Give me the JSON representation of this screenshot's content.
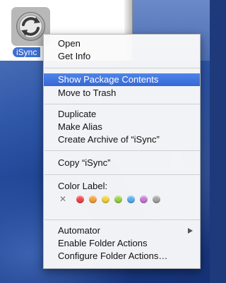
{
  "icon": {
    "name": "iSync",
    "label": "iSync"
  },
  "menu": {
    "items": [
      {
        "label": "Open",
        "group": 1
      },
      {
        "label": "Get Info",
        "group": 1
      },
      {
        "label": "Show Package Contents",
        "group": 2,
        "highlighted": true
      },
      {
        "label": "Move to Trash",
        "group": 2
      },
      {
        "label": "Duplicate",
        "group": 3
      },
      {
        "label": "Make Alias",
        "group": 3
      },
      {
        "label": "Create Archive of “iSync”",
        "group": 3
      },
      {
        "label": "Copy “iSync”",
        "group": 4
      },
      {
        "label": "Color Label:",
        "group": 5
      },
      {
        "label": "Automator",
        "group": 6,
        "submenu": true
      },
      {
        "label": "Enable Folder Actions",
        "group": 6
      },
      {
        "label": "Configure Folder Actions…",
        "group": 6
      }
    ],
    "color_labels": {
      "none_symbol": "✕",
      "colors": [
        {
          "name": "red",
          "hex": "#f0484a"
        },
        {
          "name": "orange",
          "hex": "#f6a23a"
        },
        {
          "name": "yellow",
          "hex": "#f3d43a"
        },
        {
          "name": "green",
          "hex": "#9ad443"
        },
        {
          "name": "blue",
          "hex": "#5aaef0"
        },
        {
          "name": "purple",
          "hex": "#c77ad6"
        },
        {
          "name": "gray",
          "hex": "#a5a5a5"
        }
      ]
    }
  },
  "colors": {
    "highlight": "#3d6fd0",
    "menu_bg": "#fafafa"
  }
}
